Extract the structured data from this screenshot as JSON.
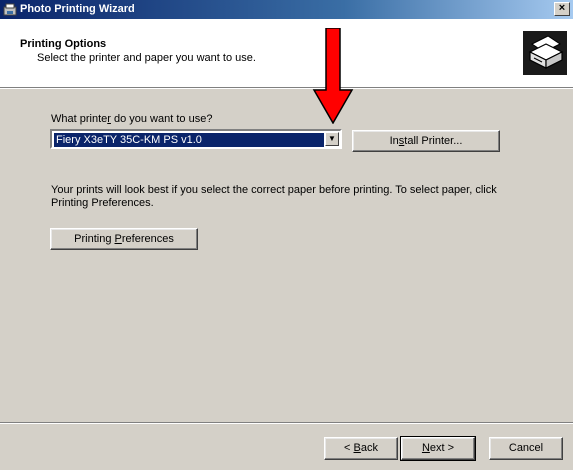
{
  "window": {
    "title": "Photo Printing Wizard",
    "close_glyph": "×"
  },
  "header": {
    "title": "Printing Options",
    "subtitle": "Select the printer and paper you want to use.",
    "icon": "printer-paper-icon"
  },
  "printer": {
    "prompt_pre": "What printe",
    "prompt_access": "r",
    "prompt_post": " do you want to use?",
    "selected": "Fiery X3eTY 35C-KM PS v1.0",
    "install_pre": "In",
    "install_access": "s",
    "install_post": "tall Printer..."
  },
  "info": {
    "text": "Your prints will look best if you select the correct paper before printing. To select paper, click Printing Preferences."
  },
  "preferences": {
    "label_pre": "Printing ",
    "label_access": "P",
    "label_post": "references"
  },
  "footer": {
    "back_pre": "< ",
    "back_access": "B",
    "back_post": "ack",
    "next_access": "N",
    "next_post": "ext >",
    "cancel": "Cancel"
  },
  "colors": {
    "titlebar_start": "#0a246a",
    "selection": "#0a246a",
    "annotation_arrow": "#ff0000",
    "dialog_bg": "#d4d0c8"
  }
}
